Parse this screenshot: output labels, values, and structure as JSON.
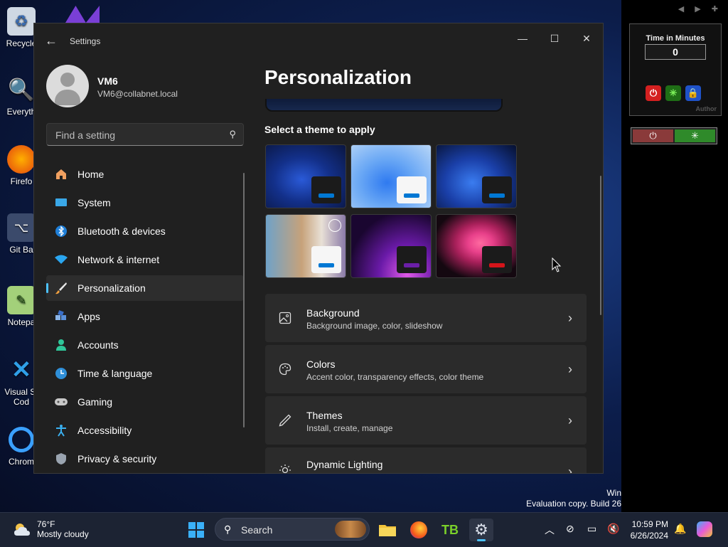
{
  "desktop": {
    "icons": [
      {
        "label": "Recycle",
        "icon": "recycle-bin-icon"
      },
      {
        "label": "Everyth",
        "icon": "everything-search-icon"
      },
      {
        "label": "Firefo",
        "icon": "firefox-icon"
      },
      {
        "label": "Git Ba",
        "icon": "git-bash-icon"
      },
      {
        "label": "Notepa",
        "icon": "notepad-icon"
      },
      {
        "label": "Visual St",
        "label2": "Cod",
        "icon": "vscode-icon"
      },
      {
        "label": "Chrom",
        "icon": "chrome-icon"
      }
    ],
    "watermark_line1": "Win",
    "watermark_line2": "Evaluation copy. Build 26"
  },
  "gadget": {
    "title": "Time in Minutes",
    "value": "0",
    "author": "Author"
  },
  "window": {
    "title": "Settings",
    "minimize_glyph": "—",
    "maximize_glyph": "☐",
    "close_glyph": "✕"
  },
  "user": {
    "name": "VM6",
    "email": "VM6@collabnet.local"
  },
  "search": {
    "placeholder": "Find a setting"
  },
  "nav": [
    {
      "label": "Home",
      "icon": "home-icon"
    },
    {
      "label": "System",
      "icon": "system-icon"
    },
    {
      "label": "Bluetooth & devices",
      "icon": "bluetooth-icon"
    },
    {
      "label": "Network & internet",
      "icon": "network-icon"
    },
    {
      "label": "Personalization",
      "icon": "brush-icon",
      "active": true
    },
    {
      "label": "Apps",
      "icon": "apps-icon"
    },
    {
      "label": "Accounts",
      "icon": "accounts-icon"
    },
    {
      "label": "Time & language",
      "icon": "clock-globe-icon"
    },
    {
      "label": "Gaming",
      "icon": "gamepad-icon"
    },
    {
      "label": "Accessibility",
      "icon": "accessibility-icon"
    },
    {
      "label": "Privacy & security",
      "icon": "shield-icon"
    }
  ],
  "main": {
    "page_title": "Personalization",
    "theme_section_label": "Select a theme to apply",
    "themes": [
      {
        "name": "theme-dark-bloom",
        "accent": "#0078d4"
      },
      {
        "name": "theme-light-bloom",
        "accent": "#0078d4"
      },
      {
        "name": "theme-dark-bloom-2",
        "accent": "#0078d4"
      },
      {
        "name": "theme-spotlight",
        "accent": "#0078d4"
      },
      {
        "name": "theme-glow",
        "accent": "#6b1fa8"
      },
      {
        "name": "theme-flow",
        "accent": "#d4141a"
      }
    ],
    "cards": [
      {
        "title": "Background",
        "subtitle": "Background image, color, slideshow",
        "icon": "picture-icon"
      },
      {
        "title": "Colors",
        "subtitle": "Accent color, transparency effects, color theme",
        "icon": "palette-icon"
      },
      {
        "title": "Themes",
        "subtitle": "Install, create, manage",
        "icon": "pen-icon"
      },
      {
        "title": "Dynamic Lighting",
        "subtitle": "",
        "icon": "sun-lighting-icon"
      }
    ]
  },
  "taskbar": {
    "weather_temp": "76°F",
    "weather_desc": "Mostly cloudy",
    "search_placeholder": "Search",
    "time": "10:59 PM",
    "date": "6/26/2024"
  },
  "colors": {
    "accent": "#4cc2ff",
    "window_bg": "#202020",
    "card_bg": "#2b2b2b"
  }
}
